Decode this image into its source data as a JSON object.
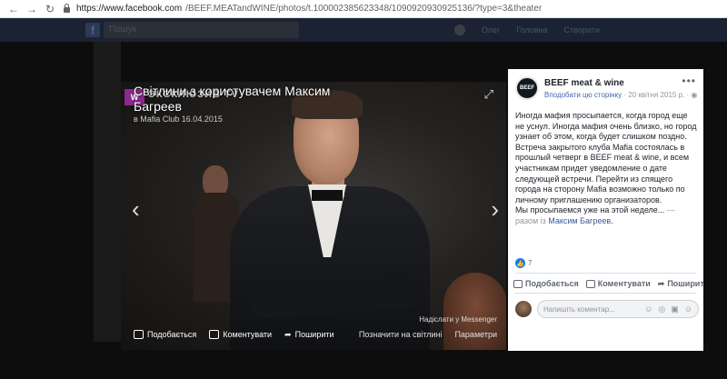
{
  "browser": {
    "url_host": "https://www.facebook.com",
    "url_path": "/BEEF.MEATandWINE/photos/t.100002385623348/1090920930925136/?type=3&theater"
  },
  "fb_header": {
    "logo": "f",
    "search_placeholder": "Пошук",
    "links": [
      "Олег",
      "Головна",
      "Створити"
    ]
  },
  "photo": {
    "title": "Світлини з користувачем Максим Багреев",
    "subtitle": "в Mafia Club 16.04.2015",
    "watermark": "ЭКСКЛЮЗИВ TV",
    "watermark_logo": "W",
    "messenger_label": "Надіслати у Messenger",
    "prev_icon": "chevron-left-icon",
    "next_icon": "chevron-right-icon",
    "expand_icon": "expand-icon"
  },
  "photo_actions": {
    "like": "Подобається",
    "comment": "Коментувати",
    "share": "Поширити",
    "mark_on_photo": "Позначити на світлині",
    "options": "Параметри"
  },
  "post": {
    "page_name": "BEEF meat & wine",
    "page_logo": "BEEF",
    "follow": "Вподобати цю сторінку",
    "date": "20 квітня 2015 р.",
    "privacy_icon": "globe-icon",
    "more_icon": "more-dots-icon",
    "body": "Иногда мафия просыпается, когда город еще не уснул. Иногда мафия очень близко, но город узнает об этом, когда будет слишком поздно. Встреча закрытого клуба Mafia состоялась в прошлый четверг в BEEF meat & wine, и всем участникам придет уведомление о дате следующей встречи. Перейти из спящего города на сторону Мafia возможно только по личному приглашению организаторов.",
    "body_last": "Мы просыпаемся уже на этой неделе...",
    "with_prefix": " — разом із ",
    "with_person": "Максим Багреев",
    "with_suffix": ".",
    "likes_count": "7",
    "actions": {
      "like": "Подобається",
      "comment": "Коментувати",
      "share": "Поширити"
    },
    "comment_placeholder": "Напишіть коментар..."
  }
}
